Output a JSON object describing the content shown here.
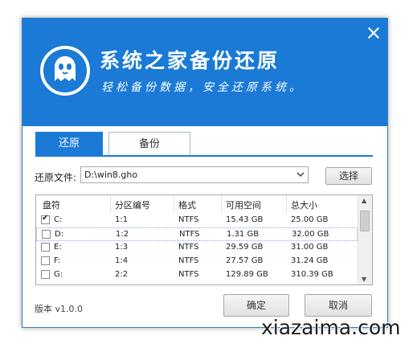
{
  "header": {
    "title": "系统之家备份还原",
    "subtitle": "轻松备份数据，安全还原系统。"
  },
  "tabs": [
    {
      "label": "还原",
      "active": true
    },
    {
      "label": "备份",
      "active": false
    }
  ],
  "restore": {
    "file_label": "还原文件:",
    "file_value": "D:\\win8.gho",
    "browse_label": "选择"
  },
  "table": {
    "columns": [
      "盘符",
      "分区编号",
      "格式",
      "可用空间",
      "总大小"
    ],
    "rows": [
      {
        "checked": true,
        "drive": "C:",
        "partition": "1:1",
        "format": "NTFS",
        "free": "15.43 GB",
        "total": "25.00 GB"
      },
      {
        "checked": false,
        "drive": "D:",
        "partition": "1:2",
        "format": "NTFS",
        "free": "1.31 GB",
        "total": "32.00 GB"
      },
      {
        "checked": false,
        "drive": "E:",
        "partition": "1:3",
        "format": "NTFS",
        "free": "29.59 GB",
        "total": "31.00 GB"
      },
      {
        "checked": false,
        "drive": "F:",
        "partition": "1:4",
        "format": "NTFS",
        "free": "27.57 GB",
        "total": "31.24 GB"
      },
      {
        "checked": false,
        "drive": "G:",
        "partition": "2:2",
        "format": "NTFS",
        "free": "129.89 GB",
        "total": "310.39 GB"
      }
    ]
  },
  "footer": {
    "version": "版本 v1.0.0",
    "confirm_label": "确定",
    "cancel_label": "取消"
  },
  "watermark": "xiazaima.com",
  "colors": {
    "accent": "#1a7ad6"
  }
}
